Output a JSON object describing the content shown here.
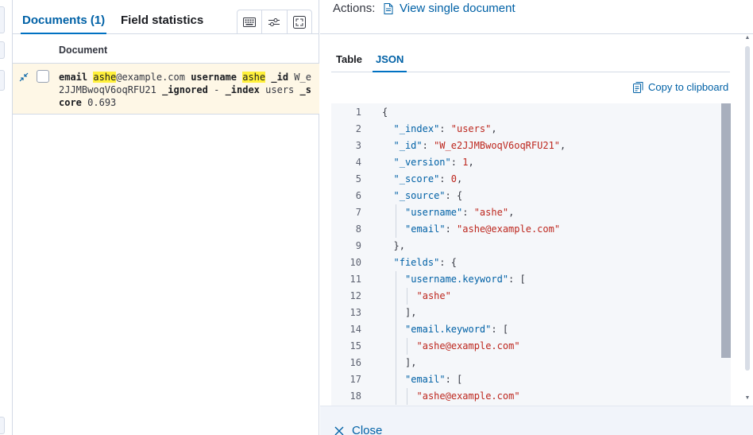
{
  "left_panel": {
    "tabs": [
      {
        "label": "Documents (1)",
        "active": true
      },
      {
        "label": "Field statistics",
        "active": false
      }
    ],
    "toolbar_icons": [
      "keyboard-icon",
      "sliders-icon",
      "fullscreen-icon"
    ],
    "column_header": "Document",
    "row": {
      "email_key": "email",
      "email_highlight": "ashe",
      "email_rest": "@example.com",
      "username_key": "username",
      "username_highlight": "ashe",
      "id_key": "_id",
      "id_value": "W_e2JJMBwoqV6oqRFU21",
      "ignored_key": "_ignored",
      "ignored_value": "-",
      "index_key": "_index",
      "index_value": "users",
      "score_key": "_score",
      "score_value": "0.693"
    }
  },
  "flyout": {
    "actions_label": "Actions:",
    "view_single_label": "View single document",
    "tabs": [
      {
        "label": "Table",
        "active": false
      },
      {
        "label": "JSON",
        "active": true
      }
    ],
    "copy_label": "Copy to clipboard",
    "close_label": "Close",
    "json_lines": [
      {
        "n": "1",
        "indent": 0,
        "parts": [
          [
            "p",
            "{"
          ]
        ]
      },
      {
        "n": "2",
        "indent": 1,
        "parts": [
          [
            "k",
            "\"_index\""
          ],
          [
            "p",
            ": "
          ],
          [
            "s",
            "\"users\""
          ],
          [
            "p",
            ","
          ]
        ]
      },
      {
        "n": "3",
        "indent": 1,
        "parts": [
          [
            "k",
            "\"_id\""
          ],
          [
            "p",
            ": "
          ],
          [
            "s",
            "\"W_e2JJMBwoqV6oqRFU21\""
          ],
          [
            "p",
            ","
          ]
        ]
      },
      {
        "n": "4",
        "indent": 1,
        "parts": [
          [
            "k",
            "\"_version\""
          ],
          [
            "p",
            ": "
          ],
          [
            "n",
            "1"
          ],
          [
            "p",
            ","
          ]
        ]
      },
      {
        "n": "5",
        "indent": 1,
        "parts": [
          [
            "k",
            "\"_score\""
          ],
          [
            "p",
            ": "
          ],
          [
            "n",
            "0"
          ],
          [
            "p",
            ","
          ]
        ]
      },
      {
        "n": "6",
        "indent": 1,
        "parts": [
          [
            "k",
            "\"_source\""
          ],
          [
            "p",
            ": {"
          ]
        ]
      },
      {
        "n": "7",
        "indent": 2,
        "parts": [
          [
            "k",
            "\"username\""
          ],
          [
            "p",
            ": "
          ],
          [
            "s",
            "\"ashe\""
          ],
          [
            "p",
            ","
          ]
        ]
      },
      {
        "n": "8",
        "indent": 2,
        "parts": [
          [
            "k",
            "\"email\""
          ],
          [
            "p",
            ": "
          ],
          [
            "s",
            "\"ashe@example.com\""
          ]
        ]
      },
      {
        "n": "9",
        "indent": 1,
        "parts": [
          [
            "p",
            "},"
          ]
        ]
      },
      {
        "n": "10",
        "indent": 1,
        "parts": [
          [
            "k",
            "\"fields\""
          ],
          [
            "p",
            ": {"
          ]
        ]
      },
      {
        "n": "11",
        "indent": 2,
        "parts": [
          [
            "k",
            "\"username.keyword\""
          ],
          [
            "p",
            ": ["
          ]
        ]
      },
      {
        "n": "12",
        "indent": 3,
        "parts": [
          [
            "s",
            "\"ashe\""
          ]
        ]
      },
      {
        "n": "13",
        "indent": 2,
        "parts": [
          [
            "p",
            "],"
          ]
        ]
      },
      {
        "n": "14",
        "indent": 2,
        "parts": [
          [
            "k",
            "\"email.keyword\""
          ],
          [
            "p",
            ": ["
          ]
        ]
      },
      {
        "n": "15",
        "indent": 3,
        "parts": [
          [
            "s",
            "\"ashe@example.com\""
          ]
        ]
      },
      {
        "n": "16",
        "indent": 2,
        "parts": [
          [
            "p",
            "],"
          ]
        ]
      },
      {
        "n": "17",
        "indent": 2,
        "parts": [
          [
            "k",
            "\"email\""
          ],
          [
            "p",
            ": ["
          ]
        ]
      },
      {
        "n": "18",
        "indent": 3,
        "parts": [
          [
            "s",
            "\"ashe@example.com\""
          ]
        ]
      }
    ]
  },
  "colors": {
    "accent": "#0061a6",
    "highlight": "#fff03b",
    "row_bg": "#fef7e6",
    "string": "#bd271e"
  }
}
